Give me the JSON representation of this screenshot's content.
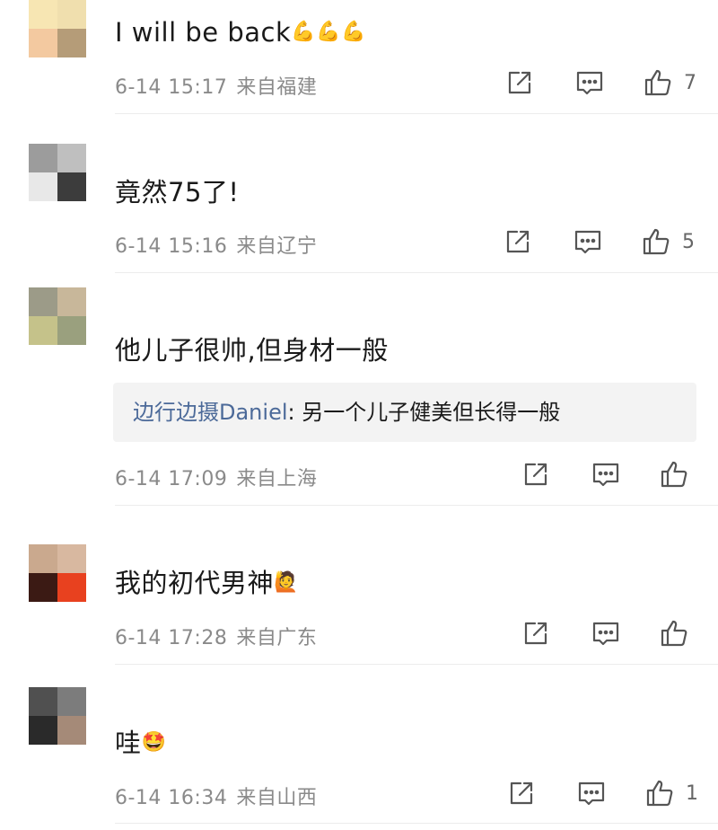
{
  "comments": [
    {
      "text": "I will be back",
      "emoji": "💪💪💪",
      "date": "6-14 15:17",
      "location": "来自福建",
      "like_count": "7",
      "avatar_colors": [
        "#f7e6b3",
        "#f0dfae",
        "#f3c9a0",
        "#b59c78"
      ]
    },
    {
      "text": "竟然75了!",
      "emoji": "",
      "date": "6-14 15:16",
      "location": "来自辽宁",
      "like_count": "5",
      "avatar_colors": [
        "#9c9c9c",
        "#bfbfbf",
        "#e8e8e8",
        "#3c3c3c"
      ]
    },
    {
      "text": "他儿子很帅,但身材一般",
      "emoji": "",
      "reply_user": "边行边摄Daniel",
      "reply_text": ": 另一个儿子健美但长得一般",
      "date": "6-14 17:09",
      "location": "来自上海",
      "like_count": "",
      "avatar_colors": [
        "#9c9b88",
        "#c8b79a",
        "#c5c28a",
        "#9aa07e"
      ]
    },
    {
      "text": "我的初代男神",
      "emoji": "🙋",
      "date": "6-14 17:28",
      "location": "来自广东",
      "like_count": "",
      "avatar_colors": [
        "#caa98e",
        "#d8b8a0",
        "#3b1a14",
        "#e8411f"
      ]
    },
    {
      "text": "哇",
      "emoji": "🤩",
      "date": "6-14 16:34",
      "location": "来自山西",
      "like_count": "1",
      "avatar_colors": [
        "#505050",
        "#7c7c7c",
        "#2a2a2a",
        "#a58a78"
      ]
    }
  ],
  "icons": {
    "share": "share-icon",
    "comment": "comment-icon",
    "like": "thumbs-up-icon"
  }
}
